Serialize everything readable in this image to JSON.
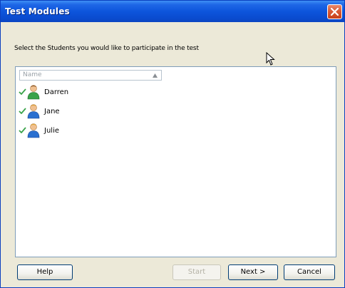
{
  "window": {
    "title": "Test Modules"
  },
  "prompt": "Select the Students you would like to participate in the test",
  "list": {
    "column_header": "Name",
    "students": [
      {
        "name": "Darren",
        "checked": true,
        "avatar_color": "#3aa34a"
      },
      {
        "name": "Jane",
        "checked": true,
        "avatar_color": "#2a6fd0"
      },
      {
        "name": "Julie",
        "checked": true,
        "avatar_color": "#2a6fd0"
      }
    ]
  },
  "buttons": {
    "help": "Help",
    "start": "Start",
    "next": "Next >",
    "cancel": "Cancel"
  }
}
